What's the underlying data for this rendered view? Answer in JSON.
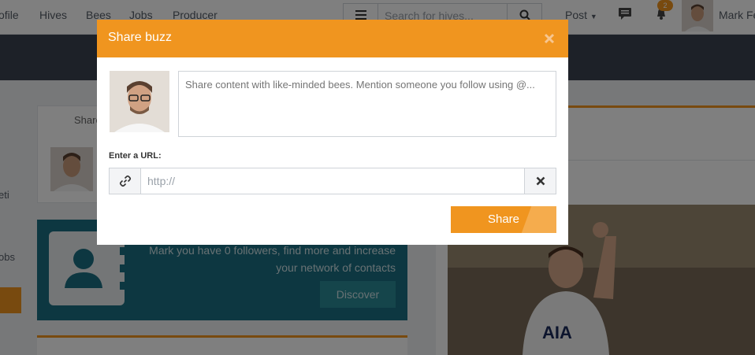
{
  "topnav": {
    "links": [
      "ofile",
      "Hives",
      "Bees",
      "Jobs",
      "Producer"
    ],
    "search_placeholder": "Search for hives...",
    "post_label": "Post",
    "notification_count": "2",
    "user_name": "Mark Fe"
  },
  "left": {
    "item_a": "eti",
    "item_b": "obs"
  },
  "share_card": {
    "label": "Share"
  },
  "followers_card": {
    "text": "Mark you have 0 followers, find more and increase your network of contacts",
    "discover_label": "Discover"
  },
  "modal": {
    "title": "Share buzz",
    "textarea_placeholder": "Share content with like-minded bees. Mention someone you follow using @...",
    "url_label": "Enter a URL:",
    "url_placeholder": "http://",
    "share_label": "Share"
  },
  "colors": {
    "accent": "#f0951f",
    "teal": "#1b6f82",
    "banner": "#3a4250"
  }
}
